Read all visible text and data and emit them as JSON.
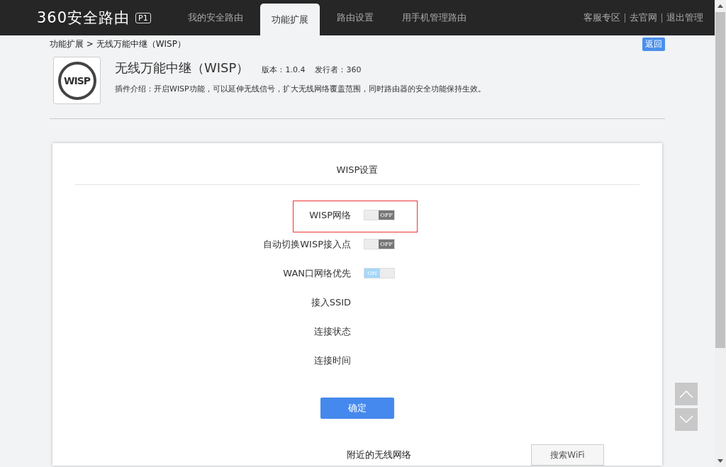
{
  "header": {
    "logo": "360安全路由",
    "model_badge": "P1",
    "nav": [
      {
        "label": "我的安全路由",
        "selected": false
      },
      {
        "label": "功能扩展",
        "selected": true
      },
      {
        "label": "路由设置",
        "selected": false
      },
      {
        "label": "用手机管理路由",
        "selected": false
      }
    ],
    "links": [
      "客服专区",
      "去官网",
      "退出管理"
    ]
  },
  "breadcrumb": "功能扩展 > 无线万能中继（WISP）",
  "back_button": "返回",
  "plugin": {
    "icon_text": "WISP",
    "title": "无线万能中继（WISP）",
    "version": "版本：1.0.4",
    "publisher": "发行者：360",
    "description": "插件介绍：开启WISP功能，可以延伸无线信号，扩大无线网络覆盖范围，同时路由器的安全功能保持生效。"
  },
  "settings": {
    "title": "WISP设置",
    "rows": [
      {
        "label": "WISP网络",
        "kind": "toggle",
        "on": false,
        "toggle_text": "OFF",
        "highlighted": true
      },
      {
        "label": "自动切换WISP接入点",
        "kind": "toggle",
        "on": false,
        "toggle_text": "OFF",
        "highlighted": false
      },
      {
        "label": "WAN口网络优先",
        "kind": "toggle",
        "on": true,
        "toggle_text": "ON",
        "highlighted": false
      },
      {
        "label": "接入SSID",
        "kind": "text",
        "highlighted": false
      },
      {
        "label": "连接状态",
        "kind": "text",
        "highlighted": false
      },
      {
        "label": "连接时间",
        "kind": "text",
        "highlighted": false
      }
    ],
    "confirm_button": "确定",
    "nearby_title": "附近的无线网络",
    "search_button": "搜索WiFi"
  }
}
